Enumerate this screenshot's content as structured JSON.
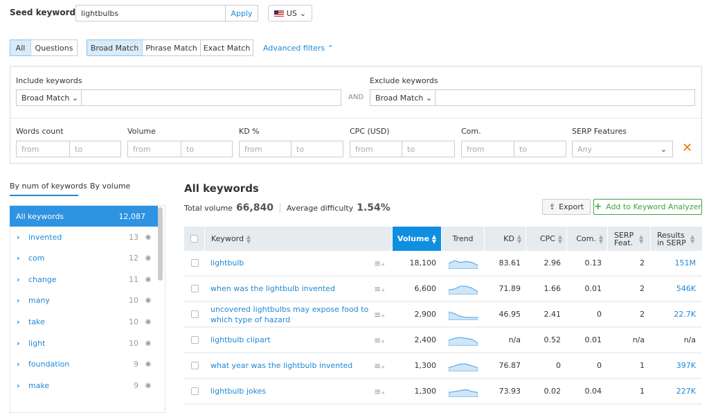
{
  "seed": {
    "label": "Seed keyword:",
    "value": "lightbulbs",
    "apply": "Apply",
    "country": "US"
  },
  "tabs": {
    "all": "All",
    "questions": "Questions",
    "broad": "Broad Match",
    "phrase": "Phrase Match",
    "exact": "Exact Match",
    "advanced": "Advanced filters"
  },
  "filters": {
    "include": "Include keywords",
    "exclude": "Exclude keywords",
    "match": "Broad Match",
    "and": "AND",
    "ranges": [
      "Words count",
      "Volume",
      "KD %",
      "CPC (USD)",
      "Com."
    ],
    "from": "from",
    "to": "to",
    "serp": "SERP Features",
    "any": "Any"
  },
  "groups": {
    "tab1": "By num of keywords",
    "tab2": "By volume",
    "all_label": "All keywords",
    "all_count": "12,087",
    "items": [
      {
        "name": "invented",
        "count": "13"
      },
      {
        "name": "com",
        "count": "12"
      },
      {
        "name": "change",
        "count": "11"
      },
      {
        "name": "many",
        "count": "10"
      },
      {
        "name": "take",
        "count": "10"
      },
      {
        "name": "light",
        "count": "10"
      },
      {
        "name": "foundation",
        "count": "9"
      },
      {
        "name": "make",
        "count": "9"
      }
    ]
  },
  "main": {
    "title": "All keywords",
    "total_label": "Total volume",
    "total": "66,840",
    "diff_label": "Average difficulty",
    "diff": "1.54%",
    "export": "Export",
    "add": "Add to Keyword Analyzer"
  },
  "table": {
    "headers": {
      "keyword": "Keyword",
      "volume": "Volume",
      "trend": "Trend",
      "kd": "KD",
      "cpc": "CPC",
      "com": "Com.",
      "serp": "SERP Feat.",
      "results": "Results in SERP"
    },
    "rows": [
      {
        "keyword": "lightbulb",
        "volume": "18,100",
        "kd": "83.61",
        "cpc": "2.96",
        "com": "0.13",
        "serp": "2",
        "results": "151M"
      },
      {
        "keyword": "when was the lightbulb invented",
        "volume": "6,600",
        "kd": "71.89",
        "cpc": "1.66",
        "com": "0.01",
        "serp": "2",
        "results": "546K"
      },
      {
        "keyword": "uncovered lightbulbs may expose food to which type of hazard",
        "volume": "2,900",
        "kd": "46.95",
        "cpc": "2.41",
        "com": "0",
        "serp": "2",
        "results": "22.7K"
      },
      {
        "keyword": "lightbulb clipart",
        "volume": "2,400",
        "kd": "n/a",
        "cpc": "0.52",
        "com": "0.01",
        "serp": "n/a",
        "results": "n/a"
      },
      {
        "keyword": "what year was the lightbulb invented",
        "volume": "1,300",
        "kd": "76.87",
        "cpc": "0",
        "com": "0",
        "serp": "1",
        "results": "397K"
      },
      {
        "keyword": "lightbulb jokes",
        "volume": "1,300",
        "kd": "73.93",
        "cpc": "0.02",
        "com": "0.04",
        "serp": "1",
        "results": "227K"
      }
    ]
  },
  "colors": {
    "accent": "#1e88d6",
    "active_header": "#0f8fe0",
    "add_green": "#3aa53a",
    "close_orange": "#f07c00"
  }
}
